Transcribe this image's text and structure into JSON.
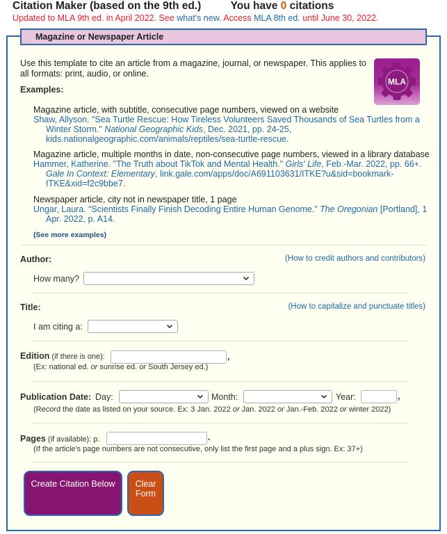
{
  "header": {
    "title": "Citation Maker (based on the 9th ed.)",
    "count_prefix": "You have ",
    "count_value": "0",
    "count_suffix": " citations",
    "update_part1": "Updated to MLA 9th ed. in April 2022. See ",
    "whats_new_link": "what's new",
    "update_part2": ". Access ",
    "mla8_link": "MLA 8th ed.",
    "update_part3": " until June 30, 2022."
  },
  "panel": {
    "tab_title": "Magazine or Newspaper Article",
    "intro": "Use this template to cite an article from a magazine, journal, or newspaper. This applies to all formats: print, audio, or online.",
    "examples_label": "Examples:",
    "logo_text": "MLA",
    "examples": [
      {
        "description": "Magazine article, with subtitle, consecutive page numbers, viewed on a website",
        "cite_pre": "Shaw, Allyson. \"Sea Turtle Rescue: How Tireless Volunteers Saved Thousands of Sea Turtles from a Winter Storm.\" ",
        "cite_italic": "National Geographic Kids",
        "cite_post": ", Dec. 2021, pp. 24-25, kids.nationalgeographic.com/animals/reptiles/sea-turtle-rescue."
      },
      {
        "description": "Magazine article, multiple months in date, non-consecutive page numbers, viewed in a library database",
        "cite_pre": "Hammer, Katherine. \"The Truth about TikTok and Mental Health.\" ",
        "cite_italic": "Girls' Life",
        "cite_mid": ", Feb.-Mar. 2022, pp. 66+. ",
        "cite_italic2": "Gale In Context: Elementary",
        "cite_post": ", link.gale.com/apps/doc/A691103631/ITKE?u&sid=bookmark-ITKE&xid=f2c9bbe7."
      },
      {
        "description": "Newspaper article, city not in newspaper title, 1 page",
        "cite_pre": "Ungar, Laura. “Scientists Finally Finish Decoding Entire Human Genome.” ",
        "cite_italic": "The Oregonian",
        "cite_post": " [Portland], 1 Apr. 2022, p. A14."
      }
    ],
    "see_more": "(See more examples)"
  },
  "form": {
    "author": {
      "label": "Author:",
      "help_link": "(How to credit authors and contributors)",
      "how_many_label": "How many?",
      "how_many_value": ""
    },
    "title": {
      "label": "Title:",
      "help_link": "(How to capitalize and punctuate titles)",
      "citing_label": "I am citing a:",
      "citing_value": ""
    },
    "edition": {
      "label": "Edition",
      "note": " (if there is one):",
      "value": "",
      "trailing": ",",
      "hint_pre": "(Ex: national ed. ",
      "hint_or1": "or",
      "hint_mid": " sunrise ed. ",
      "hint_or2": "or",
      "hint_post": " South Jersey ed.)"
    },
    "pub_date": {
      "label": "Publication Date:",
      "day_label": "Day:",
      "day_value": "",
      "month_label": "Month:",
      "month_value": "",
      "year_label": "Year:",
      "year_value": "",
      "trailing": ",",
      "hint_1": "(Record the date as listed on your source. Ex: 3 Jan. 2022 ",
      "hint_or1": "or",
      "hint_2": " Jan. 2022 ",
      "hint_or2": "or",
      "hint_3": " Jan.-Feb. 2022 ",
      "hint_or3": "or",
      "hint_4": " winter 2022)"
    },
    "pages": {
      "label": "Pages",
      "note": " (if available): p.",
      "value": "",
      "trailing": ".",
      "hint": "(If the article's page numbers are not consecutive, only list the first page and a plus sign. Ex: 37+)"
    },
    "buttons": {
      "create": "Create Citation Below",
      "clear_line1": "Clear",
      "clear_line2": "Form"
    }
  },
  "colors": {
    "accent_blue": "#2d66ad",
    "tab_pink": "#e8c6df",
    "panel_bg": "#fefef1",
    "link_blue": "#1e6aa8",
    "alert_red": "#e8212b",
    "count_orange": "#c8620e",
    "create_button": "#861471",
    "clear_button": "#c94f16"
  }
}
